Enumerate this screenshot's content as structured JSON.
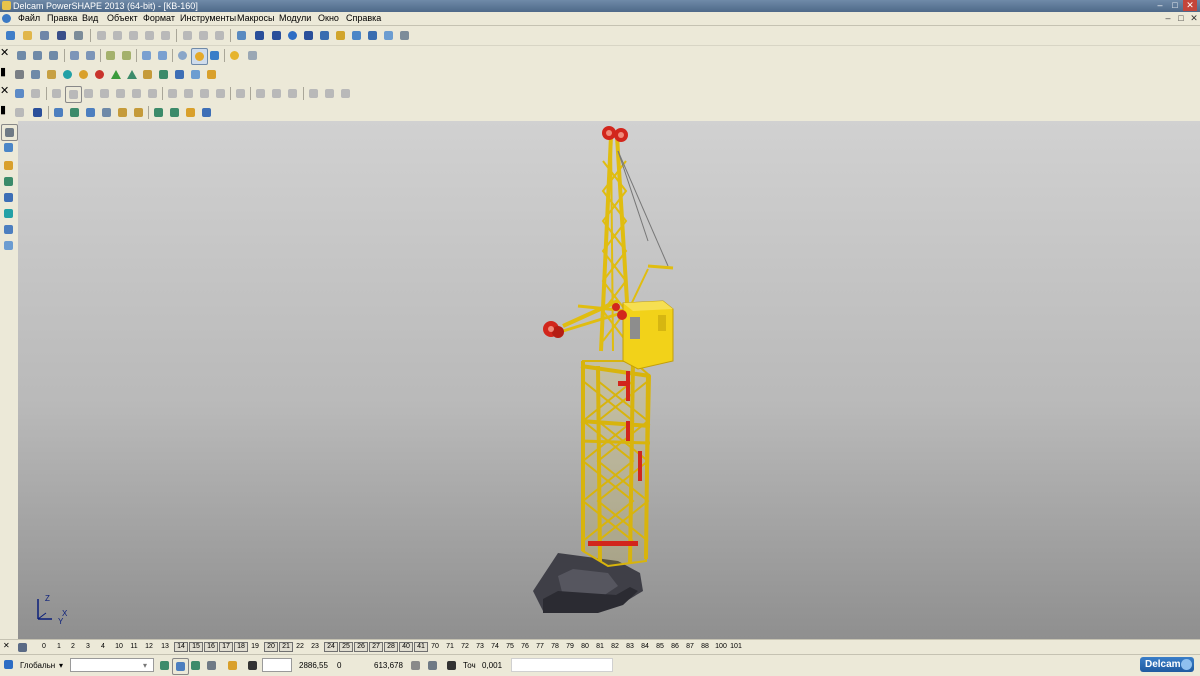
{
  "window": {
    "title": "Delcam PowerSHAPE 2013 (64-bit) - [КВ-160]",
    "minimize": "–",
    "maximize": "□",
    "close": "✕"
  },
  "menu": [
    "Файл",
    "Правка",
    "Вид",
    "Объект",
    "Формат",
    "Инструменты",
    "Макросы",
    "Модули",
    "Окно",
    "Справка"
  ],
  "layers": {
    "numbers": [
      "0",
      "1",
      "2",
      "3",
      "4",
      "10",
      "11",
      "12",
      "13",
      "14",
      "15",
      "16",
      "17",
      "18",
      "19",
      "20",
      "21",
      "22",
      "23",
      "24",
      "25",
      "26",
      "27",
      "28",
      "40",
      "41",
      "70",
      "71",
      "72",
      "73",
      "74",
      "75",
      "76",
      "77",
      "78",
      "79",
      "80",
      "81",
      "82",
      "83",
      "84",
      "85",
      "86",
      "87",
      "88",
      "100",
      "101"
    ],
    "boxed": [
      "14",
      "15",
      "16",
      "17",
      "18",
      "20",
      "21",
      "24",
      "25",
      "26",
      "27",
      "28",
      "40",
      "41"
    ]
  },
  "status": {
    "workplane": "Глобальн",
    "coord_x": "2886,55",
    "coord_y": "0",
    "coord_z": "613,678",
    "tolerance_label": "Точ",
    "tolerance_value": "0,001",
    "brand": "Delcam"
  },
  "triad": {
    "x_label": "X",
    "y_label": "Y",
    "z_label": "Z"
  },
  "colors": {
    "crane_yellow": "#f2d219",
    "wheel_red": "#d2261c",
    "base_dark": "#3f3f47",
    "viewport_top": "#d1d1d1",
    "viewport_bottom": "#8f8f8f"
  }
}
